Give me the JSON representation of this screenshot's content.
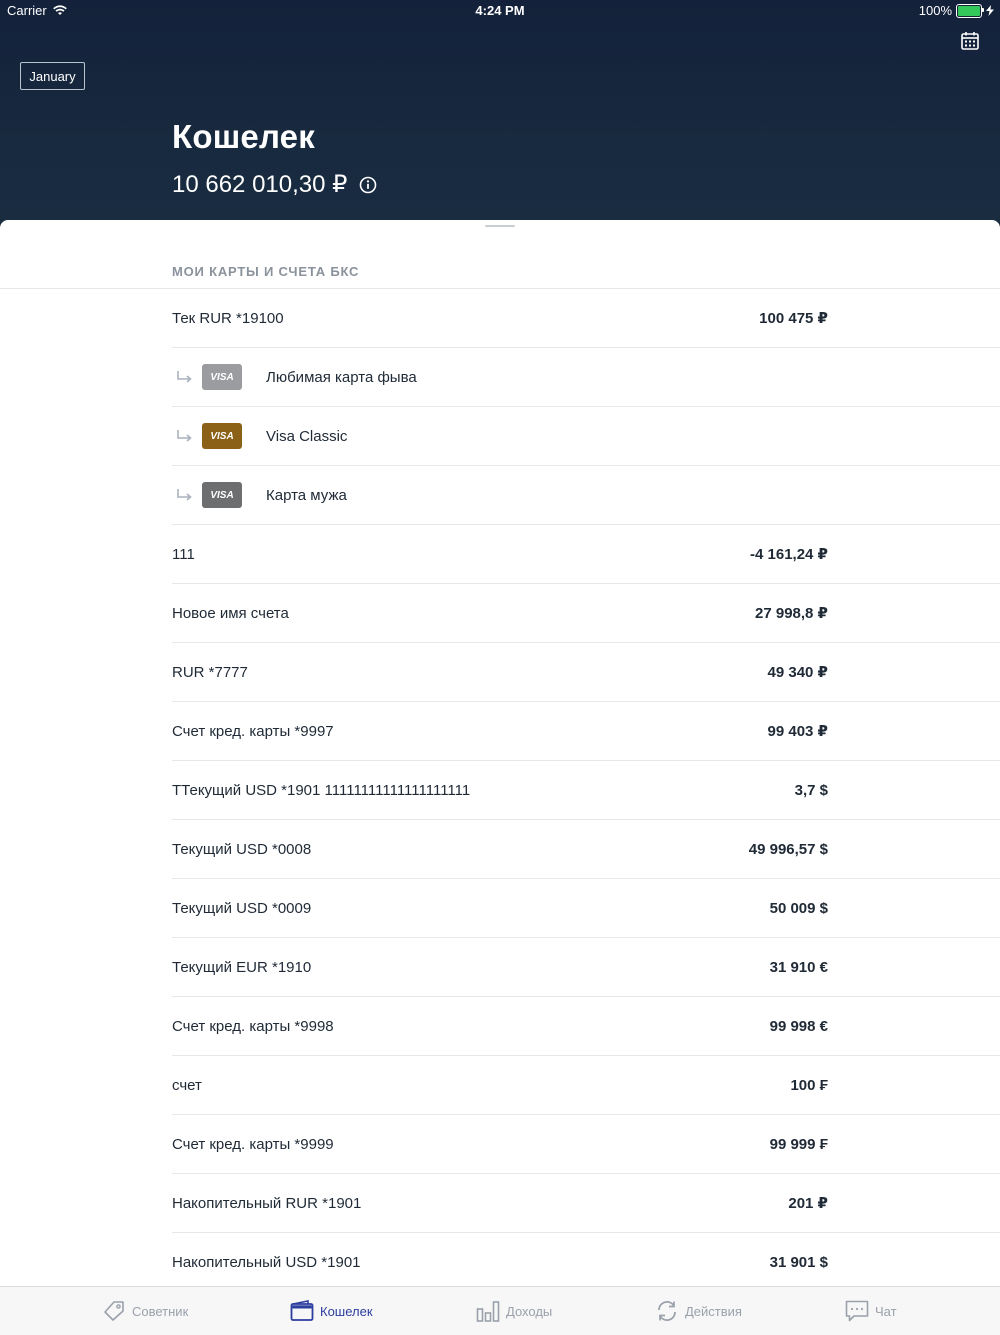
{
  "status": {
    "carrier": "Carrier",
    "time": "4:24 PM",
    "battery": "100%"
  },
  "header": {
    "month": "January",
    "title": "Кошелек",
    "balance": "10 662 010,30 ₽"
  },
  "section": {
    "title": "МОИ КАРТЫ И СЧЕТА БКС"
  },
  "rows": [
    {
      "name": "Тек RUR *19100",
      "amount": "100 475 ₽"
    },
    {
      "name": "Любимая карта фыва",
      "card_brand": "VISA",
      "card_color": "#9a9c9f"
    },
    {
      "name": "Visa Classic",
      "card_brand": "VISA",
      "card_color": "#8a6117"
    },
    {
      "name": "Карта мужа",
      "card_brand": "VISA",
      "card_color": "#6d6e70"
    },
    {
      "name": "111",
      "amount": "-4 161,24 ₽"
    },
    {
      "name": "Новое имя счета",
      "amount": "27 998,8 ₽"
    },
    {
      "name": "RUR *7777",
      "amount": "49 340 ₽"
    },
    {
      "name": "Счет кред. карты *9997",
      "amount": "99 403 ₽"
    },
    {
      "name": "ТТекущий USD *1901 11111111111111111111",
      "amount": "3,7 $"
    },
    {
      "name": "Текущий USD *0008",
      "amount": "49 996,57 $"
    },
    {
      "name": "Текущий USD *0009",
      "amount": "50 009 $"
    },
    {
      "name": "Текущий EUR *1910",
      "amount": "31 910 €"
    },
    {
      "name": "Счет кред. карты *9998",
      "amount": "99 998 €"
    },
    {
      "name": "счет",
      "amount": "100 ₣"
    },
    {
      "name": "Счет кред. карты *9999",
      "amount": "99 999 ₣"
    },
    {
      "name": "Накопительный RUR *1901",
      "amount": "201 ₽"
    },
    {
      "name": "Накопительный USD *1901",
      "amount": "31 901 $"
    }
  ],
  "tabs": [
    {
      "label": "Советник",
      "icon": "tag-icon"
    },
    {
      "label": "Кошелек",
      "icon": "wallet-icon",
      "active": true
    },
    {
      "label": "Доходы",
      "icon": "bar-chart-icon"
    },
    {
      "label": "Действия",
      "icon": "refresh-icon"
    },
    {
      "label": "Чат",
      "icon": "chat-icon"
    }
  ],
  "colors": {
    "header_bg": "#13213a",
    "accent": "#2c3e9e",
    "tab_inactive": "#9aa1aa"
  }
}
